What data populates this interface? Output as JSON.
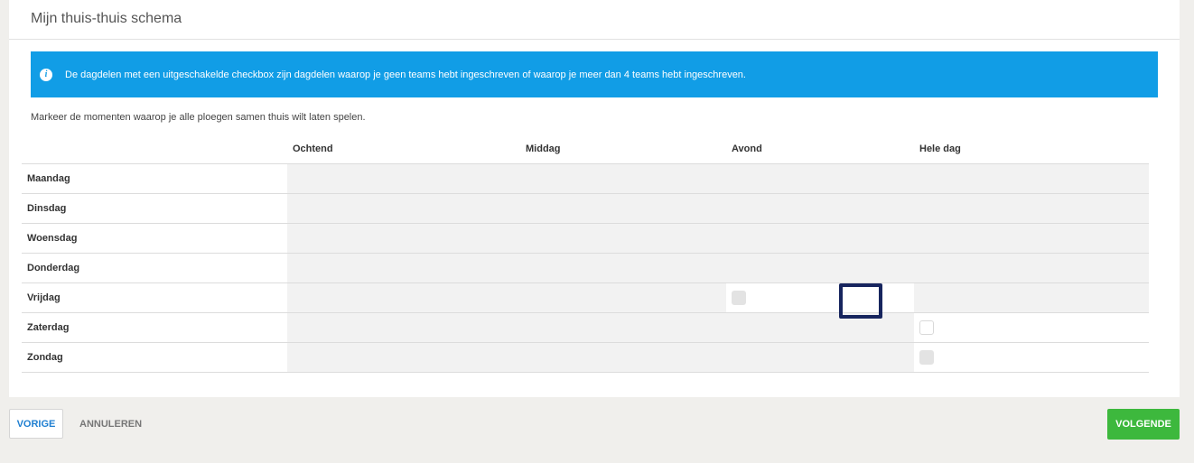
{
  "header": {
    "title": "Mijn thuis-thuis schema"
  },
  "info": {
    "icon": "info-icon",
    "text": "De dagdelen met een uitgeschakelde checkbox zijn dagdelen waarop je geen teams hebt ingeschreven of waarop je meer dan 4 teams hebt ingeschreven."
  },
  "instruction": "Markeer de momenten waarop je alle ploegen samen thuis wilt laten spelen.",
  "table": {
    "columns": [
      "Ochtend",
      "Middag",
      "Avond",
      "Hele dag"
    ],
    "rows": [
      {
        "day": "Maandag",
        "cells": [
          "none",
          "none",
          "none",
          "none"
        ]
      },
      {
        "day": "Dinsdag",
        "cells": [
          "none",
          "none",
          "none",
          "none"
        ]
      },
      {
        "day": "Woensdag",
        "cells": [
          "none",
          "none",
          "none",
          "none"
        ]
      },
      {
        "day": "Donderdag",
        "cells": [
          "none",
          "none",
          "none",
          "none"
        ]
      },
      {
        "day": "Vrijdag",
        "cells": [
          "none",
          "none",
          "disabled",
          "none"
        ]
      },
      {
        "day": "Zaterdag",
        "cells": [
          "none",
          "none",
          "none",
          "enabled"
        ]
      },
      {
        "day": "Zondag",
        "cells": [
          "none",
          "none",
          "none",
          "disabled"
        ]
      }
    ]
  },
  "footer": {
    "prev_label": "VORIGE",
    "cancel_label": "ANNULEREN",
    "next_label": "VOLGENDE"
  },
  "colors": {
    "info_bg": "#119de6",
    "primary_green": "#3db83d",
    "link_blue": "#1f7fd1",
    "focus_outline": "#17255e"
  }
}
